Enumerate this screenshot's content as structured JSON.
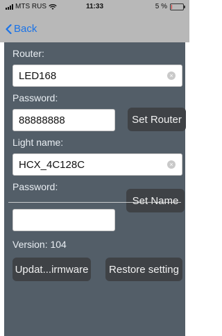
{
  "status_bar": {
    "carrier": "MTS RUS",
    "time": "11:33",
    "battery": "5 %",
    "battery_level": 0.05
  },
  "nav": {
    "back_label": "Back"
  },
  "router": {
    "label": "Router:",
    "value": "LED168"
  },
  "router_password": {
    "label": "Password:",
    "value": "88888888",
    "set_button": "Set Router"
  },
  "light_name": {
    "label": "Light name:",
    "value": "HCX_4C128C"
  },
  "light_password": {
    "label": "Password:",
    "value": "",
    "set_button": "Set Name"
  },
  "version_text": "Version: 104",
  "actions": {
    "update_label": "Updat...irmware",
    "restore_label": "Restore setting"
  },
  "colors": {
    "panel": "#535e68",
    "button": "#3f4246",
    "link": "#1a73e8"
  }
}
